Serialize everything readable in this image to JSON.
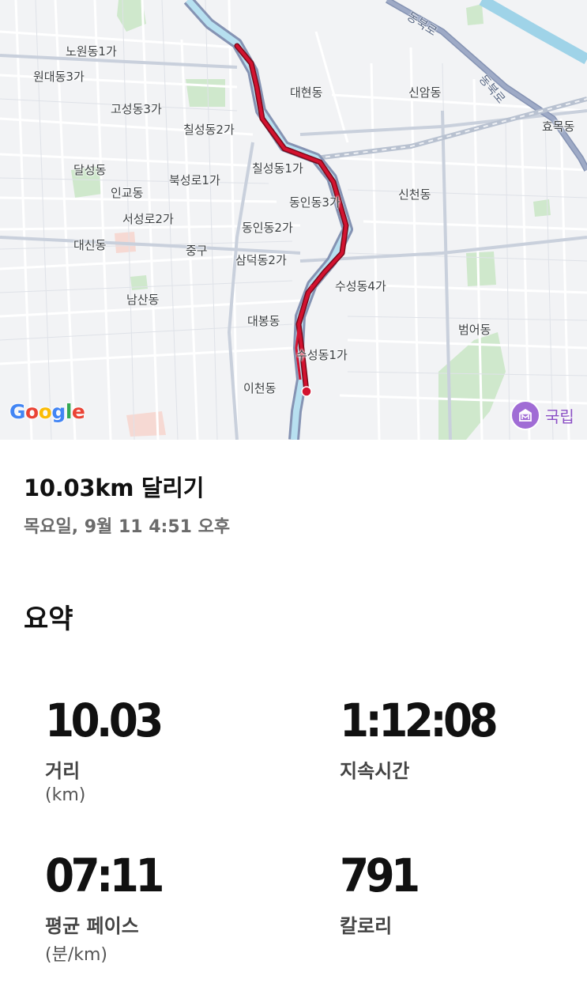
{
  "map": {
    "labels": [
      {
        "id": "nowon1ga",
        "text": "노원동1가"
      },
      {
        "id": "wondae3ga",
        "text": "원대동3가"
      },
      {
        "id": "gosung3ga",
        "text": "고성동3가"
      },
      {
        "id": "chilsung2ga",
        "text": "칠성동2가"
      },
      {
        "id": "daehyeon",
        "text": "대현동"
      },
      {
        "id": "sinam",
        "text": "신암동"
      },
      {
        "id": "hyomok",
        "text": "효목동"
      },
      {
        "id": "dalseong",
        "text": "달성동"
      },
      {
        "id": "bukseongro1ga",
        "text": "북성로1가"
      },
      {
        "id": "chilsung1ga",
        "text": "칠성동1가"
      },
      {
        "id": "ingyo",
        "text": "인교동"
      },
      {
        "id": "dongin3ga",
        "text": "동인동3가"
      },
      {
        "id": "sincheon",
        "text": "신천동"
      },
      {
        "id": "seoseongro2ga",
        "text": "서성로2가"
      },
      {
        "id": "dongin2ga",
        "text": "동인동2가"
      },
      {
        "id": "daesin",
        "text": "대신동"
      },
      {
        "id": "junggu",
        "text": "중구"
      },
      {
        "id": "samdeok2ga",
        "text": "삼덕동2가"
      },
      {
        "id": "suseong4ga",
        "text": "수성동4가"
      },
      {
        "id": "namsan",
        "text": "남산동"
      },
      {
        "id": "daebong",
        "text": "대봉동"
      },
      {
        "id": "beomeo",
        "text": "범어동"
      },
      {
        "id": "suseong1ga",
        "text": "수성동1가"
      },
      {
        "id": "icheon",
        "text": "이천동"
      }
    ],
    "road_labels": [
      {
        "id": "dongbukro-1",
        "text": "동북로"
      },
      {
        "id": "dongbukro-2",
        "text": "동북로"
      }
    ],
    "google_logo": {
      "G": "G",
      "o1": "o",
      "o2": "o",
      "g": "g",
      "l": "l",
      "e": "e"
    },
    "poi_label": "국립",
    "route_color": "#c8102e"
  },
  "activity": {
    "title": "10.03km 달리기",
    "date": "목요일, 9월 11 4:51 오후"
  },
  "summary": {
    "title": "요약",
    "distance": {
      "value": "10.03",
      "label": "거리",
      "unit": "(km)"
    },
    "duration": {
      "value": "1:12:08",
      "label": "지속시간"
    },
    "pace": {
      "value": "07:11",
      "label": "평균 페이스",
      "unit": "(분/km)"
    },
    "calories": {
      "value": "791",
      "label": "칼로리"
    }
  }
}
